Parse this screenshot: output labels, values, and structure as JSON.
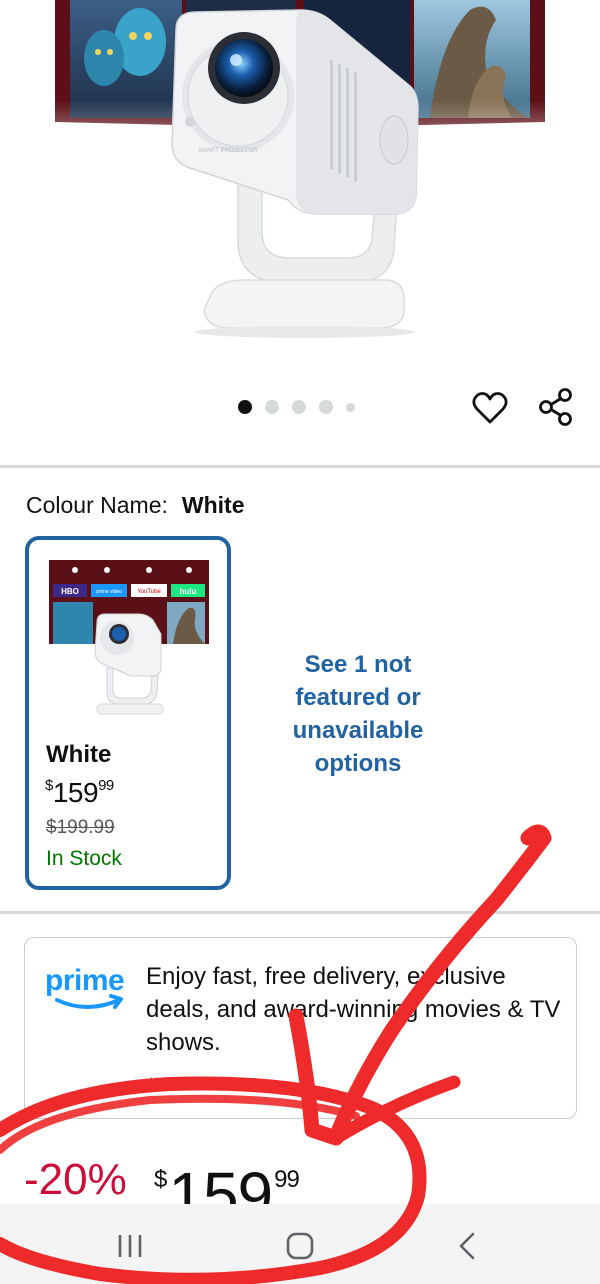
{
  "hero": {
    "device_label": "SMART PROJECTOR"
  },
  "carousel": {
    "dot_count": 5,
    "active_index": 0
  },
  "colour": {
    "label": "Colour Name:",
    "selected": "White"
  },
  "swatch": {
    "name": "White",
    "price_currency": "$",
    "price_whole": "159",
    "price_cents": "99",
    "was_price": "$199.99",
    "stock": "In Stock",
    "thumb_apps": [
      "HBO",
      "prime video",
      "YouTube",
      "hulu"
    ]
  },
  "see_more": "See 1 not featured or unavailable options",
  "prime": {
    "logo_text": "prime",
    "message": "Enjoy fast, free delivery, exclusive deals, and award-winning movies & TV shows.",
    "more": "..."
  },
  "price": {
    "discount": "-20%",
    "currency": "$",
    "whole": "159",
    "cents": "99"
  },
  "colors": {
    "link_blue": "#2162a1",
    "stock_green": "#007600",
    "deal_red": "#cc0c39",
    "annotation_red": "#ee2a2a",
    "prime_blue": "#1a98ff"
  },
  "icons": {
    "wishlist": "heart-icon",
    "share": "share-icon",
    "nav_recents": "recent-apps-icon",
    "nav_home": "home-icon",
    "nav_back": "back-icon"
  }
}
